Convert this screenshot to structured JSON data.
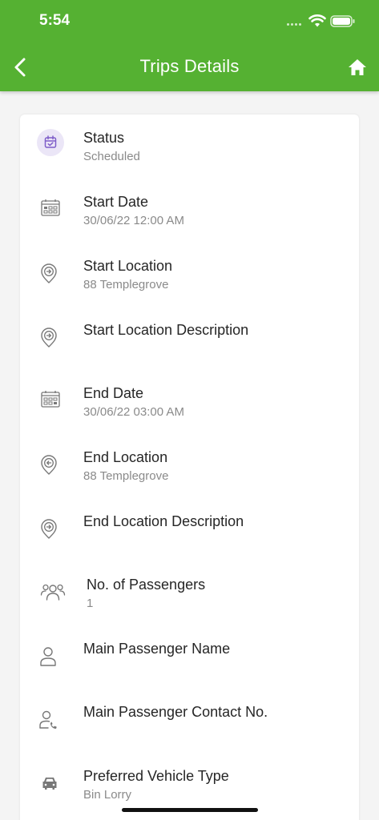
{
  "status_bar": {
    "time": "5:54"
  },
  "header": {
    "title": "Trips Details"
  },
  "details": [
    {
      "label": "Status",
      "value": "Scheduled",
      "icon": "calendar-check-icon"
    },
    {
      "label": "Start Date",
      "value": "30/06/22 12:00 AM",
      "icon": "calendar-icon"
    },
    {
      "label": "Start Location",
      "value": "88 Templegrove",
      "icon": "location-arrow-right-icon"
    },
    {
      "label": "Start Location Description",
      "value": "",
      "icon": "location-arrow-right-icon"
    },
    {
      "label": "End Date",
      "value": "30/06/22 03:00 AM",
      "icon": "calendar-icon"
    },
    {
      "label": "End Location",
      "value": "88 Templegrove",
      "icon": "location-arrow-left-icon"
    },
    {
      "label": "End Location Description",
      "value": "",
      "icon": "location-arrow-right-icon"
    },
    {
      "label": "No. of Passengers",
      "value": "1",
      "icon": "passengers-icon"
    },
    {
      "label": "Main Passenger Name",
      "value": "",
      "icon": "person-icon"
    },
    {
      "label": "Main Passenger Contact No.",
      "value": "",
      "icon": "person-phone-icon"
    },
    {
      "label": "Preferred Vehicle Type",
      "value": "Bin Lorry",
      "icon": "car-icon"
    }
  ],
  "colors": {
    "appbar": "#55b132",
    "status_icon_bg": "#ebe6f7",
    "status_icon": "#7e5dc9"
  }
}
